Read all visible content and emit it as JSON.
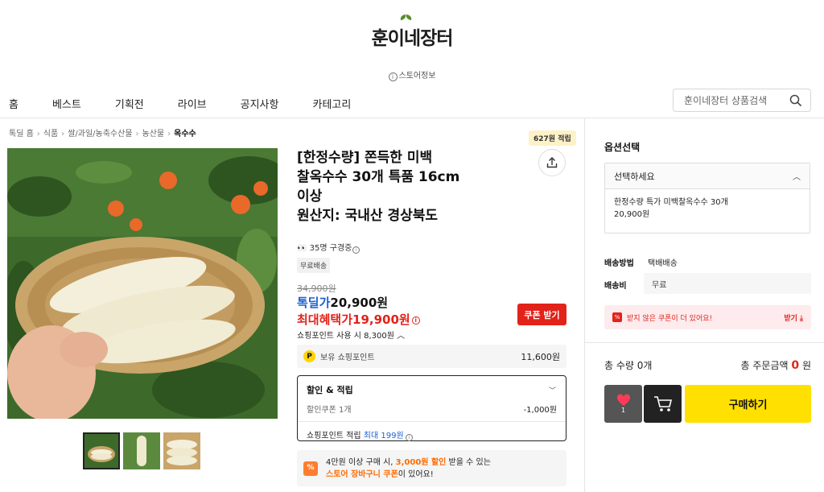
{
  "store": {
    "name": "훈이네장터",
    "info_label": "스토어정보"
  },
  "nav": {
    "items": [
      "홈",
      "베스트",
      "기획전",
      "라이브",
      "공지사항",
      "카테고리"
    ]
  },
  "search": {
    "placeholder": "훈이네장터 상품검색"
  },
  "breadcrumb": [
    "톡딜 홈",
    "식품",
    "쌀/과일/농축수산물",
    "농산물",
    "옥수수"
  ],
  "points_badge": "627원 적립",
  "product": {
    "title_lines": [
      "[한정수량] 쫀득한 미백",
      "찰옥수수 30개 특품 16cm",
      "이상",
      "원산지: 국내산 경상북도"
    ],
    "viewers": "35명 구경중",
    "shipping_tag": "무료배송",
    "original_price": "34,900원",
    "deal_label": "톡딜가",
    "deal_price": "20,900원",
    "max_label": "최대혜택가",
    "max_price": "19,900원",
    "coupon_button": "쿠폰 받기",
    "point_use": "쇼핑포인트 사용 시 8,300원",
    "point_icon": "P",
    "owned_points_label": "보유 쇼핑포인트",
    "owned_points_value": "11,600원",
    "discount": {
      "title": "할인 & 적립",
      "coupon_label": "할인쿠폰 1개",
      "coupon_value": "-1,000원",
      "points_label": "쇼핑포인트 적립",
      "points_max": "최대 199원"
    },
    "promo": {
      "icon": "%",
      "line1_pre": "4만원 이상 구매 시, ",
      "line1_amt": "3,000원 할인",
      "line1_post": " 받을 수 있는",
      "line2_hl": "스토어 장바구니 쿠폰",
      "line2_post": "이 있어요!"
    }
  },
  "option": {
    "title": "옵션선택",
    "select_placeholder": "선택하세요",
    "item_name": "한정수량 특가 미백찰옥수수 30개",
    "item_price": "20,900원"
  },
  "shipping": {
    "method_label": "배송방법",
    "method_value": "택배배송",
    "fee_label": "배송비",
    "fee_value": "무료"
  },
  "unused_coupon": {
    "text": "받지 않은 쿠폰이 더 있어요!",
    "action": "받기"
  },
  "totals": {
    "qty_label": "총 수량",
    "qty_value": "0개",
    "amount_label": "총 주문금액",
    "amount_value": "0",
    "amount_unit": "원"
  },
  "buttons": {
    "like_count": "1",
    "buy": "구매하기"
  },
  "colors": {
    "accent_red": "#e2231a",
    "accent_blue": "#1a5fd1",
    "buy_yellow": "#ffe000",
    "promo_orange": "#ff6a00"
  }
}
